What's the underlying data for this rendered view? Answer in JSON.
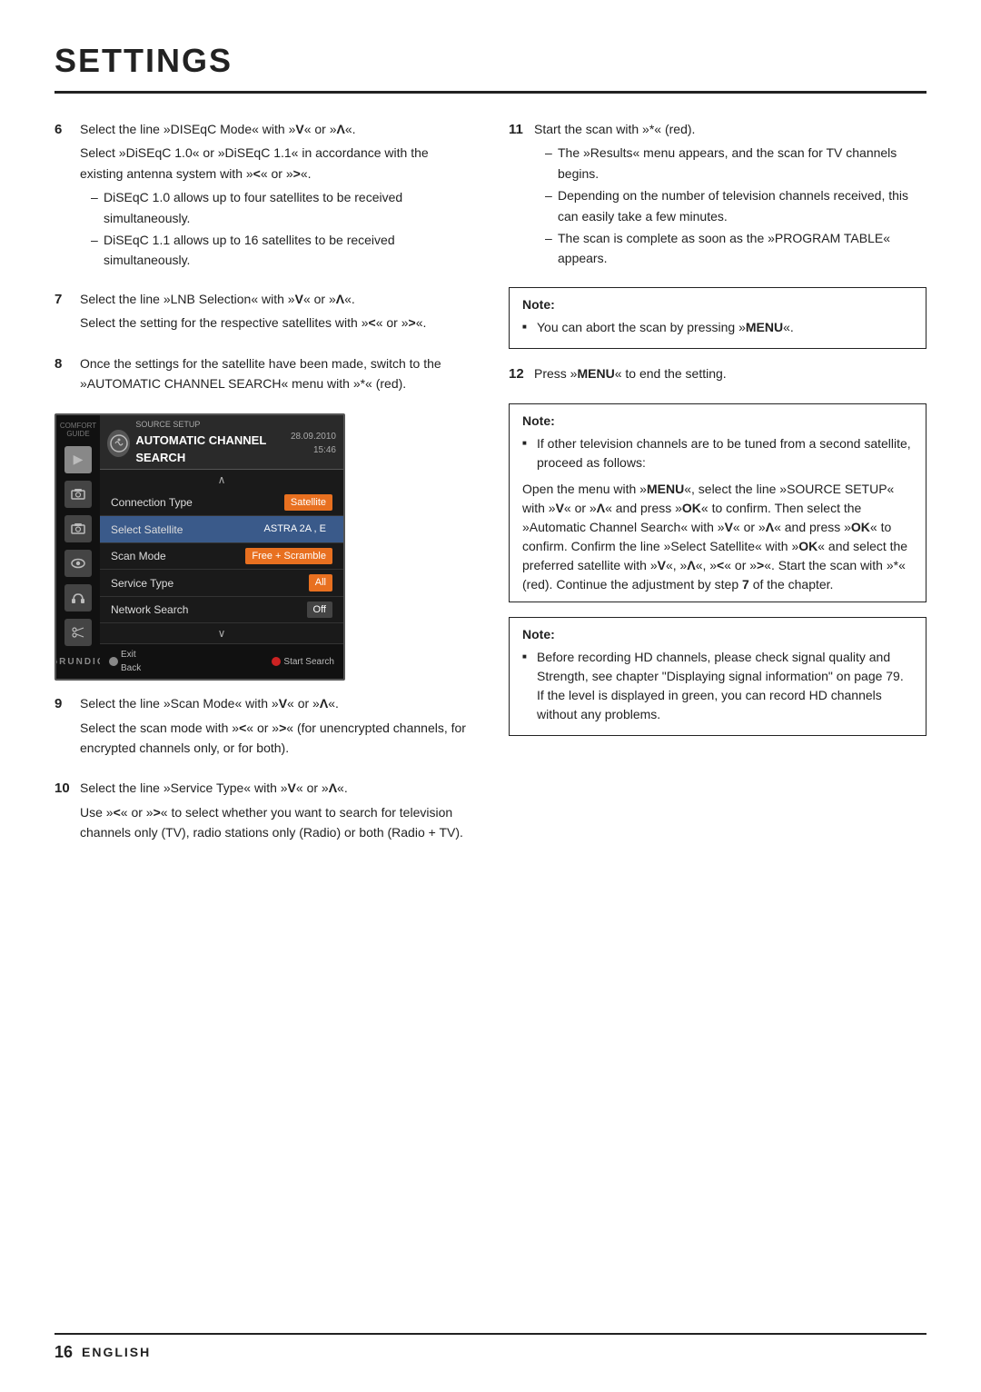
{
  "page": {
    "title": "SETTINGS",
    "footer": {
      "page_num": "16",
      "lang": "ENGLISH"
    }
  },
  "left_col": {
    "items": [
      {
        "num": "6",
        "para1": "Select the line »DISEqC Mode« with »V« or »Λ«.",
        "para2": "Select »DiSEqC 1.0« or »DiSEqC 1.1« in accordance with the existing antenna system with »<« or »>«.",
        "bullets": [
          "DiSEqC 1.0 allows up to four satellites to be received simultaneously.",
          "DiSEqC 1.1 allows up to 16 satellites to be received simultaneously."
        ]
      },
      {
        "num": "7",
        "para1": "Select the line »LNB Selection« with »V« or »Λ«.",
        "para2": "Select the setting for the respective satellites with »<« or »>«."
      },
      {
        "num": "8",
        "para1": "Once the settings for the satellite have been made, switch to the »AUTOMATIC CHANNEL SEARCH« menu with »*« (red)."
      }
    ],
    "tv_ui": {
      "source_label": "SOURCE SETUP",
      "title": "AUTOMATIC CHANNEL SEARCH",
      "date": "28.09.2010",
      "time": "15:46",
      "rows": [
        {
          "label": "Connection Type",
          "value": "Satellite",
          "style": "orange"
        },
        {
          "label": "Select Satellite",
          "value": "ASTRA 2A , E",
          "style": "blue"
        },
        {
          "label": "Scan Mode",
          "value": "Free + Scramble",
          "style": "orange"
        },
        {
          "label": "Service Type",
          "value": "All",
          "style": "orange"
        },
        {
          "label": "Network Search",
          "value": "Off",
          "style": "dark"
        }
      ],
      "sidebar_icons": [
        "▶",
        "📷",
        "📷",
        "◎",
        "↩",
        "✂"
      ],
      "footer_left": "Exit Back",
      "footer_right": "Start Search",
      "brand": "GRUNDIG"
    },
    "items2": [
      {
        "num": "9",
        "para1": "Select the line »Scan Mode« with »V« or »Λ«.",
        "para2": "Select the scan mode with »<« or »>« (for unencrypted channels, for encrypted channels only, or for both)."
      },
      {
        "num": "10",
        "para1": "Select the line »Service Type« with »V« or »Λ«.",
        "para2": "Use »<« or »>« to select whether you want to search for television channels only (TV), radio stations only (Radio) or both (Radio + TV)."
      }
    ]
  },
  "right_col": {
    "items": [
      {
        "num": "11",
        "para1": "Start the scan with »*« (red).",
        "bullets": [
          "The »Results« menu appears, and the scan for TV channels begins.",
          "Depending on the number of television channels received, this can easily take a few minutes.",
          "The scan is complete as soon as the »PROGRAM TABLE« appears."
        ]
      }
    ],
    "note1": {
      "title": "Note:",
      "bullets": [
        "You can abort the scan by pressing »MENU«."
      ]
    },
    "items2": [
      {
        "num": "12",
        "para1": "Press »MENU« to end the setting."
      }
    ],
    "note2": {
      "title": "Note:",
      "bullets": [
        "If other television channels are to be tuned from a second satellite, proceed as follows:"
      ]
    },
    "note3_text": "Open the menu with »MENU«, select the line »SOURCE SETUP« with »V« or »Λ« and press »OK« to confirm. Then select the »Automatic Channel Search« with »V« or »Λ« and press »OK« to confirm. Confirm the line »Select Satellite« with »OK« and select the preferred satellite with »V«, »Λ«, »<« or »>«. Start the scan with »*« (red). Continue the adjustment by step 7 of the chapter.",
    "note4": {
      "title": "Note:",
      "bullets": [
        "Before recording HD channels, please check signal quality and Strength, see chapter \"Displaying signal information\" on page 79. If the level is displayed in green, you can record HD channels without any problems."
      ]
    }
  }
}
